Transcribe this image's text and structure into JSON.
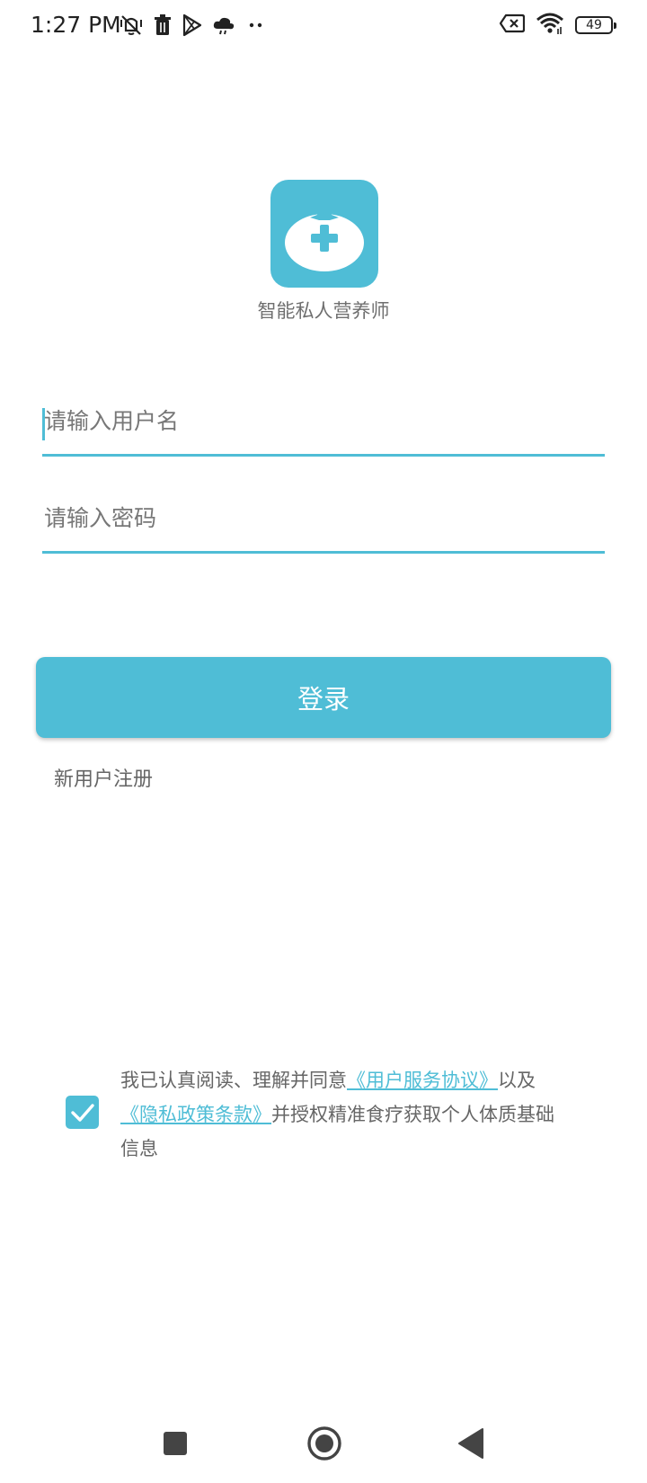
{
  "status_bar": {
    "time": "1:27 PM",
    "battery_level": "49",
    "icons": [
      "vibrate-off-icon",
      "trash-icon",
      "play-store-icon",
      "cloud-icon",
      "more-dots-icon",
      "battery-saver-x-icon",
      "wifi-icon",
      "battery-icon"
    ]
  },
  "app": {
    "name": "智能私人营养师",
    "logo_icon": "tomato-plus-icon"
  },
  "form": {
    "username_placeholder": "请输入用户名",
    "password_placeholder": "请输入密码",
    "login_label": "登录",
    "register_label": "新用户注册"
  },
  "agreement": {
    "checked": true,
    "prefix": "我已认真阅读、理解并同意",
    "service_link": "《用户服务协议》",
    "middle": "以及",
    "privacy_link": "《隐私政策条款》",
    "suffix": "并授权精准食疗获取个人体质基础信息"
  },
  "nav": {
    "icons": [
      "recents-square-icon",
      "home-circle-icon",
      "back-triangle-icon"
    ]
  },
  "colors": {
    "accent": "#4fbdd6",
    "text_secondary": "#666666",
    "background": "#ffffff"
  }
}
